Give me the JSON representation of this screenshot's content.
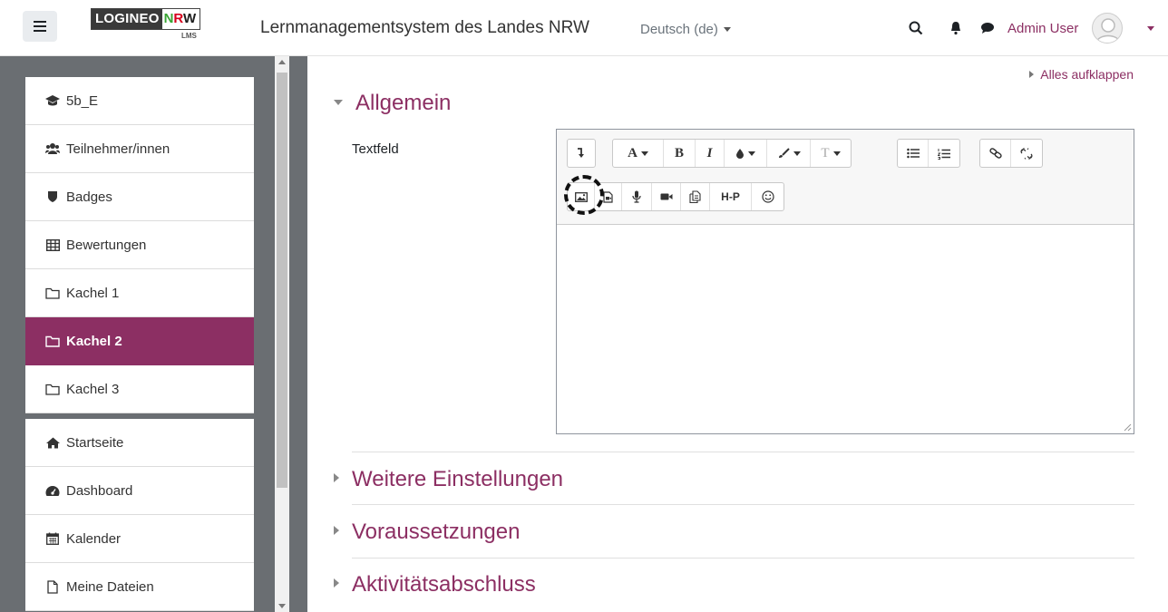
{
  "navbar": {
    "logo_left": "LOGINEO",
    "logo_n": "N",
    "logo_r": "R",
    "logo_w": "W",
    "logo_sub": "LMS",
    "site_name": "Lernmanagementsystem des Landes NRW",
    "language": "Deutsch (de)",
    "user_name": "Admin User"
  },
  "drawer": {
    "items": [
      {
        "label": "5b_E",
        "icon": "graduation-cap-icon"
      },
      {
        "label": "Teilnehmer/innen",
        "icon": "users-icon"
      },
      {
        "label": "Badges",
        "icon": "shield-icon"
      },
      {
        "label": "Bewertungen",
        "icon": "table-icon"
      },
      {
        "label": "Kachel 1",
        "icon": "folder-icon"
      },
      {
        "label": "Kachel 2",
        "icon": "folder-icon",
        "active": true
      },
      {
        "label": "Kachel 3",
        "icon": "folder-icon"
      },
      {
        "label": "Startseite",
        "icon": "home-icon"
      },
      {
        "label": "Dashboard",
        "icon": "dashboard-icon"
      },
      {
        "label": "Kalender",
        "icon": "calendar-icon"
      },
      {
        "label": "Meine Dateien",
        "icon": "file-icon"
      }
    ]
  },
  "main": {
    "expand_all": "Alles aufklappen",
    "section_general": "Allgemein",
    "field_label": "Textfeld",
    "sections": [
      "Weitere Einstellungen",
      "Voraussetzungen",
      "Aktivitätsabschluss"
    ]
  },
  "editor": {
    "toolbar_row1": [
      "show-more-icon",
      "font-color-icon",
      "bold-icon",
      "italic-icon",
      "background-color-icon",
      "brush-icon",
      "font-size-icon",
      "unordered-list-icon",
      "ordered-list-icon",
      "link-icon",
      "unlink-icon"
    ],
    "toolbar_row2": [
      "image-icon",
      "media-icon",
      "record-audio-icon",
      "record-video-icon",
      "manage-files-icon",
      "h5p-icon",
      "emoji-icon"
    ],
    "bold_label": "B",
    "italic_label": "I",
    "font_label": "A",
    "h5p_label": "H-P",
    "size_label": "T"
  },
  "colors": {
    "brand": "#8c2f63",
    "drawer_bg": "#6a6e72"
  }
}
